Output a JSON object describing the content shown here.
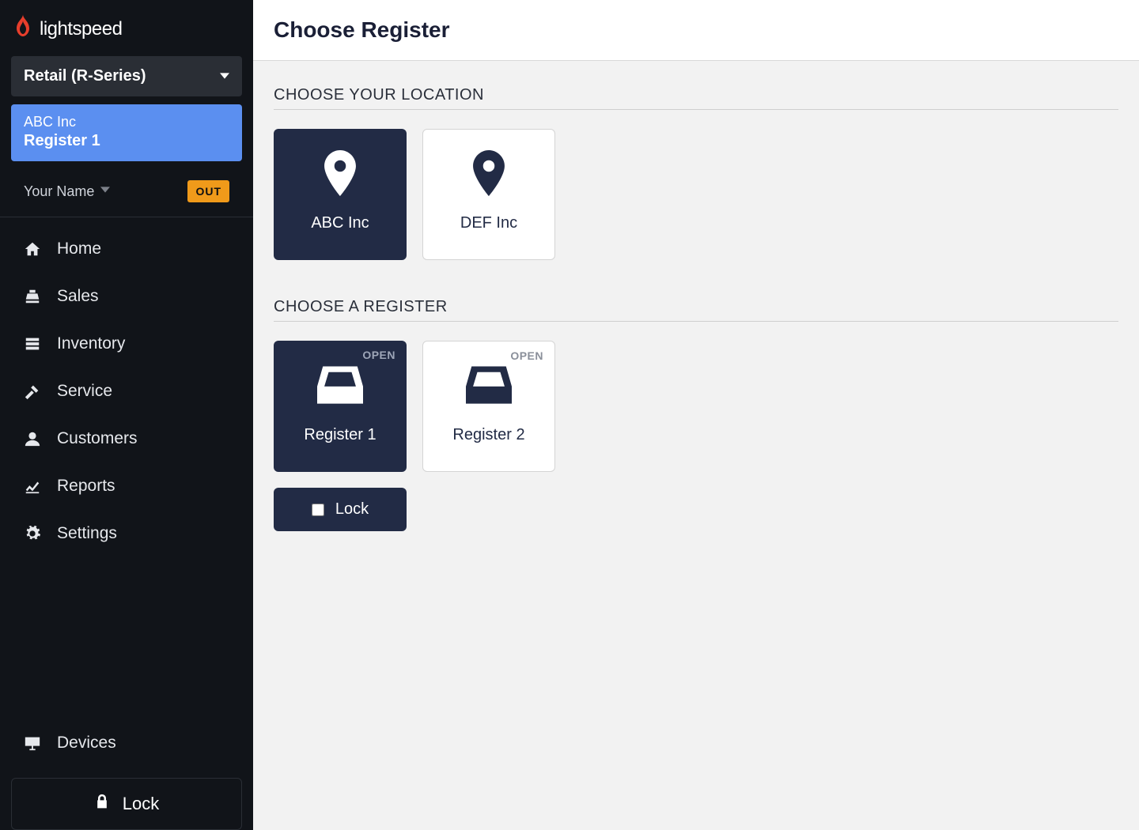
{
  "brand": "lightspeed",
  "product_select": "Retail (R-Series)",
  "context": {
    "company": "ABC Inc",
    "register": "Register 1"
  },
  "user": {
    "name": "Your Name",
    "badge": "OUT"
  },
  "nav": {
    "items": [
      {
        "label": "Home"
      },
      {
        "label": "Sales"
      },
      {
        "label": "Inventory"
      },
      {
        "label": "Service"
      },
      {
        "label": "Customers"
      },
      {
        "label": "Reports"
      },
      {
        "label": "Settings"
      }
    ],
    "devices": "Devices",
    "lock": "Lock"
  },
  "page": {
    "title": "Choose Register",
    "location_heading": "CHOOSE YOUR LOCATION",
    "locations": [
      {
        "label": "ABC Inc"
      },
      {
        "label": "DEF Inc"
      }
    ],
    "register_heading": "CHOOSE A REGISTER",
    "registers": [
      {
        "label": "Register 1",
        "status": "OPEN"
      },
      {
        "label": "Register 2",
        "status": "OPEN"
      }
    ],
    "lock_label": "Lock"
  }
}
